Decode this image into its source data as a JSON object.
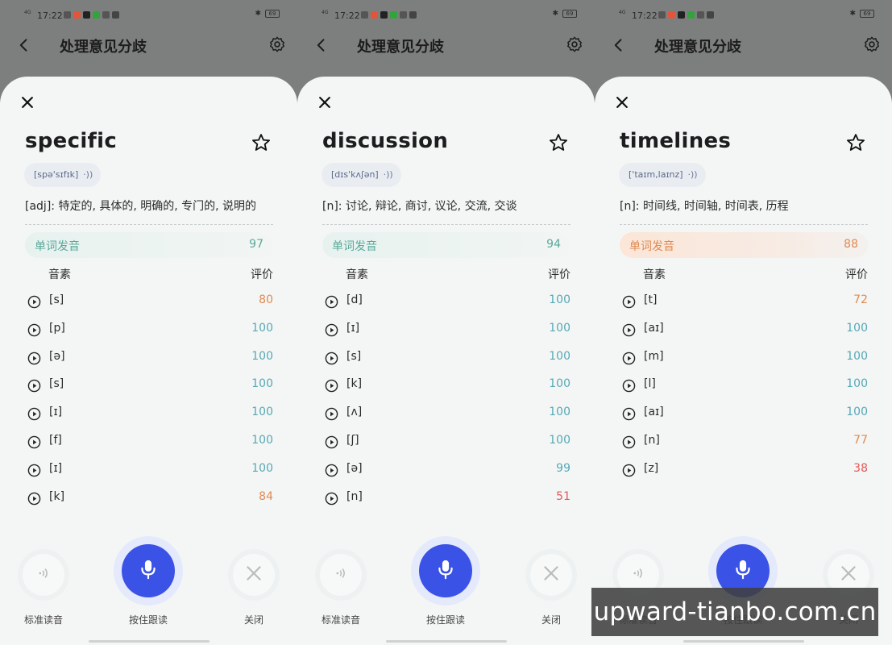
{
  "status_bar": {
    "time": "17:22",
    "network": "4G",
    "battery": "69",
    "icon_colors": [
      "#555555",
      "#e0553b",
      "#222222",
      "#33a33c",
      "#555555",
      "#444444"
    ]
  },
  "header": {
    "title": "处理意见分歧",
    "back_icon": "chevron-left-icon",
    "settings_icon": "gear-icon"
  },
  "labels": {
    "score_label": "单词发音",
    "phoneme_header": "音素",
    "rating_header": "评价",
    "standard_audio": "标准读音",
    "hold_to_read": "按住跟读",
    "close": "关闭"
  },
  "colors": {
    "green": "#5aa99a",
    "teal": "#56a8b6",
    "orange": "#e08a52",
    "red": "#e05a5a",
    "mic_blue": "#3a52e6"
  },
  "cards": [
    {
      "word": "specific",
      "ipa": "[spə'sɪfɪk]",
      "definition": "[adj]: 特定的, 具体的, 明确的, 专门的, 说明的",
      "score": "97",
      "score_color": "#5aa99a",
      "score_bar_style": "good",
      "phonemes": [
        {
          "symbol": "[s]",
          "score": "80",
          "color": "#e08a52"
        },
        {
          "symbol": "[p]",
          "score": "100",
          "color": "#56a8b6"
        },
        {
          "symbol": "[ə]",
          "score": "100",
          "color": "#56a8b6"
        },
        {
          "symbol": "[s]",
          "score": "100",
          "color": "#56a8b6"
        },
        {
          "symbol": "[ɪ]",
          "score": "100",
          "color": "#56a8b6"
        },
        {
          "symbol": "[f]",
          "score": "100",
          "color": "#56a8b6"
        },
        {
          "symbol": "[ɪ]",
          "score": "100",
          "color": "#56a8b6"
        },
        {
          "symbol": "[k]",
          "score": "84",
          "color": "#e08a52"
        }
      ]
    },
    {
      "word": "discussion",
      "ipa": "[dɪs'kʌʃən]",
      "definition": "[n]: 讨论, 辩论, 商讨, 议论, 交流, 交谈",
      "score": "94",
      "score_color": "#5aa99a",
      "score_bar_style": "good",
      "phonemes": [
        {
          "symbol": "[d]",
          "score": "100",
          "color": "#56a8b6"
        },
        {
          "symbol": "[ɪ]",
          "score": "100",
          "color": "#56a8b6"
        },
        {
          "symbol": "[s]",
          "score": "100",
          "color": "#56a8b6"
        },
        {
          "symbol": "[k]",
          "score": "100",
          "color": "#56a8b6"
        },
        {
          "symbol": "[ʌ]",
          "score": "100",
          "color": "#56a8b6"
        },
        {
          "symbol": "[ʃ]",
          "score": "100",
          "color": "#56a8b6"
        },
        {
          "symbol": "[ə]",
          "score": "99",
          "color": "#56a8b6"
        },
        {
          "symbol": "[n]",
          "score": "51",
          "color": "#e05a5a"
        }
      ]
    },
    {
      "word": "timelines",
      "ipa": "['taɪm,laɪnz]",
      "definition": "[n]: 时间线, 时间轴, 时间表, 历程",
      "score": "88",
      "score_color": "#e08a52",
      "score_bar_style": "warn",
      "phonemes": [
        {
          "symbol": "[t]",
          "score": "72",
          "color": "#e08a52"
        },
        {
          "symbol": "[aɪ]",
          "score": "100",
          "color": "#56a8b6"
        },
        {
          "symbol": "[m]",
          "score": "100",
          "color": "#56a8b6"
        },
        {
          "symbol": "[l]",
          "score": "100",
          "color": "#56a8b6"
        },
        {
          "symbol": "[aɪ]",
          "score": "100",
          "color": "#56a8b6"
        },
        {
          "symbol": "[n]",
          "score": "77",
          "color": "#e08a52"
        },
        {
          "symbol": "[z]",
          "score": "38",
          "color": "#e05a5a"
        }
      ]
    }
  ],
  "watermark": "upward-tianbo.com.cn"
}
